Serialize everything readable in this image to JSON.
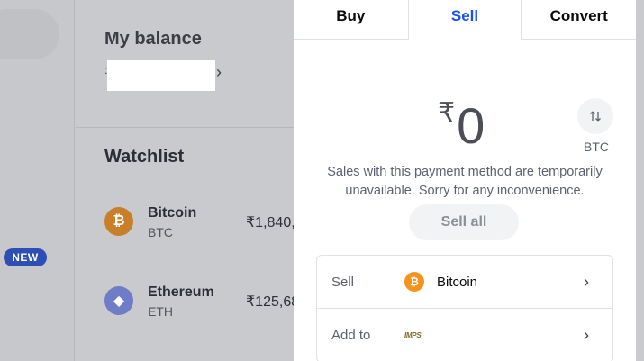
{
  "background": {
    "new_badge": "NEW",
    "balance_title": "My balance",
    "balance_chevron": "›",
    "watchlist_title": "Watchlist",
    "watchlist": [
      {
        "name": "Bitcoin",
        "symbol": "BTC",
        "price": "₹1,840,",
        "icon": "bitcoin-icon",
        "color": "#c97f2a"
      },
      {
        "name": "Ethereum",
        "symbol": "ETH",
        "price": "₹125,68",
        "icon": "ethereum-icon",
        "color": "#6f7cc7"
      }
    ]
  },
  "modal": {
    "tabs": [
      {
        "label": "Buy",
        "active": false
      },
      {
        "label": "Sell",
        "active": true
      },
      {
        "label": "Convert",
        "active": false
      }
    ],
    "currency_symbol": "₹",
    "amount": "0",
    "swap_icon": "swap-vertical-icon",
    "swap_label": "BTC",
    "notice": "Sales with this payment method are temporarily unavailable. Sorry for any inconvenience.",
    "sell_all_label": "Sell all",
    "rows": [
      {
        "label": "Sell",
        "value": "Bitcoin",
        "icon": "bitcoin-icon"
      },
      {
        "label": "Add to",
        "value": "IMPS",
        "icon": "bank-logo-icon"
      }
    ],
    "chevron": "›"
  },
  "colors": {
    "accent": "#1652f0",
    "badge": "#2d4fb3",
    "bitcoin": "#f7931a"
  }
}
